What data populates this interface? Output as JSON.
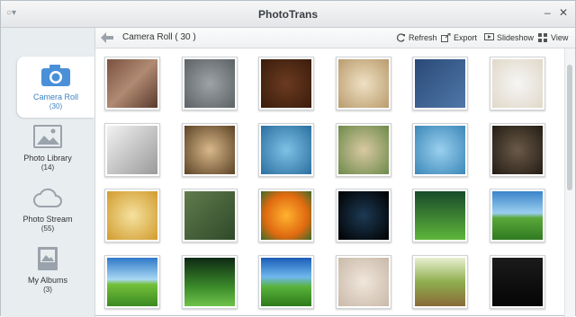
{
  "app": {
    "title": "PhotoTrans"
  },
  "window": {
    "minimize": "‒",
    "close": "✕"
  },
  "sidebar": {
    "items": [
      {
        "label": "Camera Roll",
        "count": "(30)",
        "icon": "camera-icon"
      },
      {
        "label": "Photo Library",
        "count": "(14)",
        "icon": "photo-library-icon"
      },
      {
        "label": "Photo Stream",
        "count": "(55)",
        "icon": "cloud-icon"
      },
      {
        "label": "My Albums",
        "count": "(3)",
        "icon": "albums-icon"
      }
    ]
  },
  "toolbar": {
    "breadcrumb": "Camera Roll  ( 30 )",
    "refresh": "Refresh",
    "export": "Export",
    "slideshow": "Slideshow",
    "view": "View"
  },
  "colors": {
    "accent": "#3b82c4",
    "sidebar_bg": "#e8edf0"
  },
  "thumbnails": [
    {
      "name": "apple-logo-stone",
      "bg": "linear-gradient(135deg,#7a5240,#b08a72 50%,#5a3a2c)"
    },
    {
      "name": "apple-logo-metal",
      "bg": "radial-gradient(circle,#9ea3a6,#5b6164)"
    },
    {
      "name": "apple-coffee-beans",
      "bg": "radial-gradient(circle,#6b3b20,#3a1c0c)"
    },
    {
      "name": "apple-photo-collage",
      "bg": "radial-gradient(circle,#efe1c4,#b99b6d)"
    },
    {
      "name": "apple-jeans",
      "bg": "linear-gradient(135deg,#2a4a78,#4f77a8)"
    },
    {
      "name": "rabbid-april-fool",
      "bg": "radial-gradient(circle,#f6f6f6,#e0d8c8)"
    },
    {
      "name": "rabbid-toilet",
      "bg": "linear-gradient(135deg,#f2f2f2,#9a9a9a)"
    },
    {
      "name": "rabbid-portrait",
      "bg": "radial-gradient(circle,#d9b88a,#5b4326)"
    },
    {
      "name": "rabbid-pirate-blue",
      "bg": "radial-gradient(circle,#7fc1e6,#2b6f9f)"
    },
    {
      "name": "rabbid-green",
      "bg": "radial-gradient(circle,#d9c9a3,#6d8a4a)"
    },
    {
      "name": "rabbid-cow",
      "bg": "radial-gradient(circle,#9ad0ef,#3b87b8)"
    },
    {
      "name": "rabbid-pirate-dark",
      "bg": "radial-gradient(circle,#6a5a48,#241c14)"
    },
    {
      "name": "rabbid-pharaoh",
      "bg": "radial-gradient(circle,#f5e2a0,#d19b2d)"
    },
    {
      "name": "people-outdoors",
      "bg": "linear-gradient(135deg,#5f7b4c,#2f4a2a)"
    },
    {
      "name": "orange-flower",
      "bg": "radial-gradient(circle,#ffb330,#e06a10 60%,#3b6a2a)"
    },
    {
      "name": "cartoon-dark",
      "bg": "radial-gradient(circle,#1c3a54,#000)"
    },
    {
      "name": "green-hills-1",
      "bg": "linear-gradient(#174a2a,#5fb63a)"
    },
    {
      "name": "green-field-sky",
      "bg": "linear-gradient(#3a84c9,#9bcff0 45%,#5aa83a 55%,#2f7a22)"
    },
    {
      "name": "green-field-blue",
      "bg": "linear-gradient(#2e78c9,#a9d8f3 45%,#74c03a 55%,#3a8a22)"
    },
    {
      "name": "green-hill-dark",
      "bg": "linear-gradient(#0e2a14,#3b8a2a 60%,#6fc34a)"
    },
    {
      "name": "green-hill-bright",
      "bg": "linear-gradient(#1a5cb8,#6fb8ec 40%,#58b23a 60%,#2e7a1a)"
    },
    {
      "name": "pink-heart",
      "bg": "radial-gradient(circle,#f0e6dc,#c9b9a8)"
    },
    {
      "name": "country-road",
      "bg": "linear-gradient(#e7f0d0,#8fae4e 50%,#8a6a3a)"
    },
    {
      "name": "dark-quote",
      "bg": "linear-gradient(#1b1b1b,#050505)"
    }
  ]
}
